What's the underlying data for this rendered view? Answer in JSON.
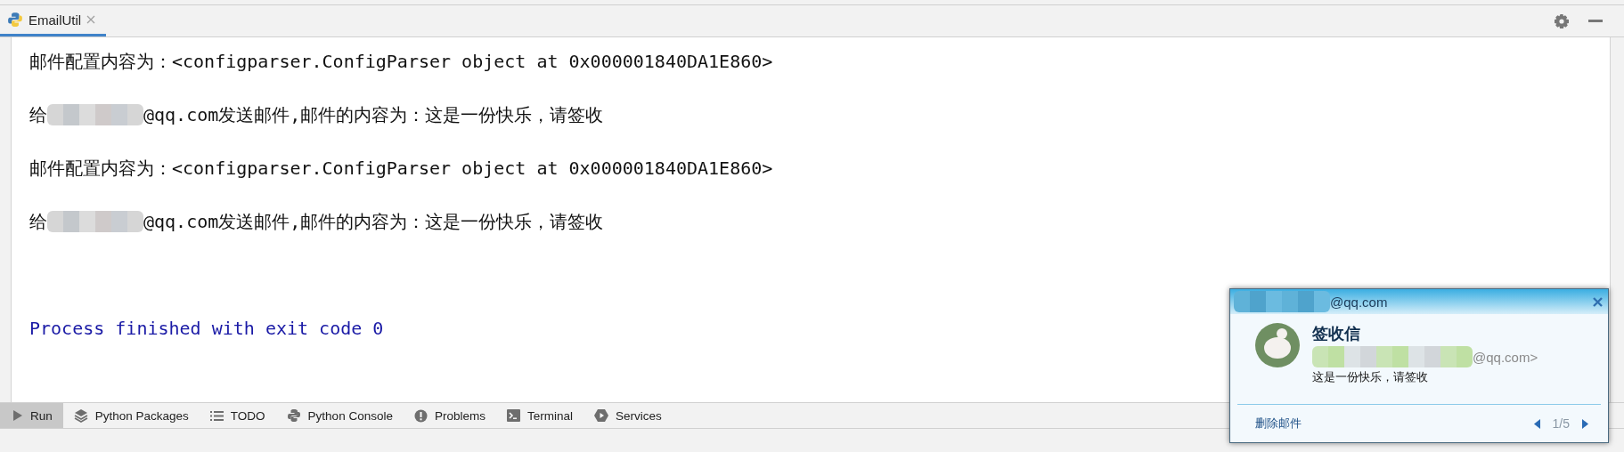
{
  "tab": {
    "label": "EmailUtil",
    "selected": true
  },
  "console": {
    "lines": [
      {
        "kind": "plain",
        "text": "邮件配置内容为：<configparser.ConfigParser object at 0x000001840DA1E860>"
      },
      {
        "kind": "masked",
        "prefix": "给",
        "suffix": "@qq.com发送邮件,邮件的内容为：这是一份快乐，请签收"
      },
      {
        "kind": "plain",
        "text": "邮件配置内容为：<configparser.ConfigParser object at 0x000001840DA1E860>"
      },
      {
        "kind": "masked",
        "prefix": "给",
        "suffix": "@qq.com发送邮件,邮件的内容为：这是一份快乐，请签收"
      },
      {
        "kind": "exit",
        "text": "Process finished with exit code 0"
      }
    ]
  },
  "tool_tabs": [
    {
      "label": "Run",
      "kind": "run",
      "selected": true
    },
    {
      "label": "Python Packages",
      "kind": "packages",
      "selected": false
    },
    {
      "label": "TODO",
      "kind": "todo",
      "selected": false
    },
    {
      "label": "Python Console",
      "kind": "console",
      "selected": false
    },
    {
      "label": "Problems",
      "kind": "problems",
      "selected": false
    },
    {
      "label": "Terminal",
      "kind": "terminal",
      "selected": false
    },
    {
      "label": "Services",
      "kind": "services",
      "selected": false
    }
  ],
  "notification": {
    "account": "@qq.com",
    "subject": "签收信",
    "sender": "@qq.com>",
    "preview": "这是一份快乐，请签收",
    "delete_link": "删除邮件",
    "pager": "1/5"
  }
}
